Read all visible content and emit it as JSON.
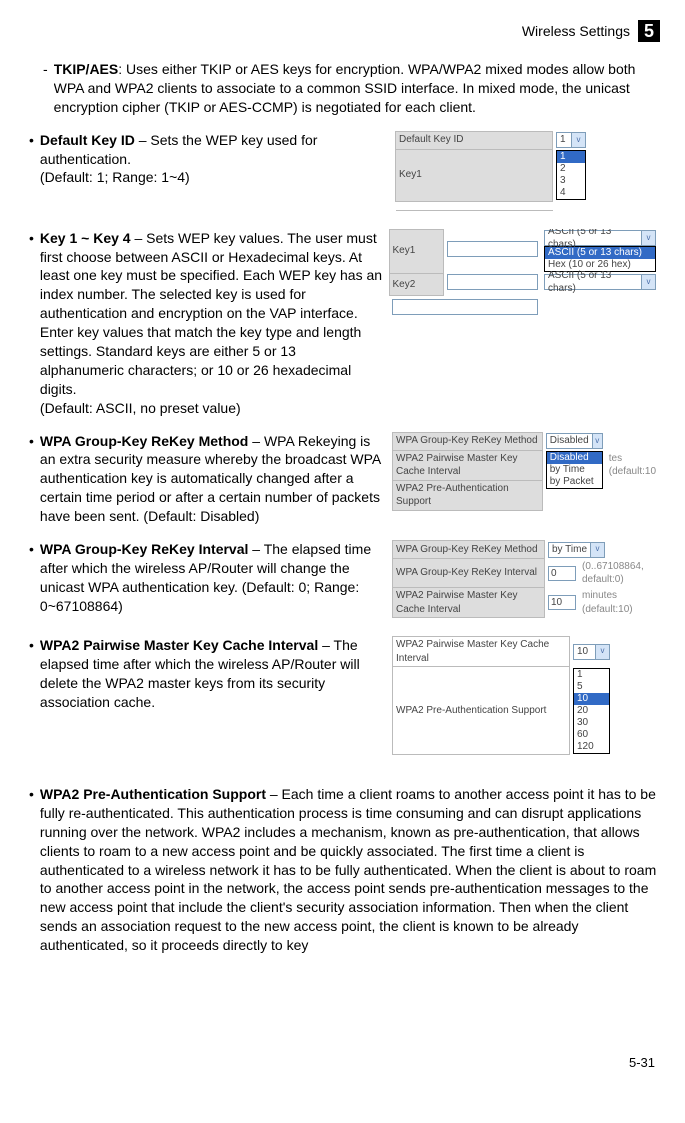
{
  "header": {
    "title": "Wireless Settings",
    "chapter": "5"
  },
  "tkip": {
    "heading": "TKIP/AES",
    "text": ": Uses either TKIP or AES keys for encryption. WPA/WPA2 mixed modes allow both WPA and WPA2 clients to associate to a common SSID interface. In mixed mode, the unicast encryption cipher (TKIP or AES-CCMP) is negotiated for each client."
  },
  "defaultKey": {
    "heading": "Default Key ID",
    "text": " – Sets the WEP key used for authentication.",
    "note": "(Default: 1; Range: 1~4)",
    "fig": {
      "row1": "Default Key ID",
      "row2": "Key1",
      "dd_current": "1",
      "options": [
        "1",
        "2",
        "3",
        "4"
      ]
    }
  },
  "keyRange": {
    "heading": "Key 1 ~ Key 4",
    "text": " – Sets WEP key values. The user must first choose between ASCII or Hexadecimal keys.  At least one key must be specified. Each WEP key has an index number. The selected key is used for authentication and encryption on the VAP interface. Enter key values that match the key type and length settings. Standard keys are either 5 or 13 alphanumeric characters; or 10 or 26 hexadecimal digits.",
    "note": "(Default: ASCII, no preset value)",
    "fig": {
      "row1": "Key1",
      "row2": "Key2",
      "dd1": "ASCII (5 or 13 chars)",
      "opts": [
        "ASCII (5 or 13 chars)",
        "Hex (10 or 26 hex)"
      ],
      "dd2": "ASCII (5 or 13 chars)"
    }
  },
  "rekeyMethod": {
    "heading": "WPA Group-Key ReKey Method",
    "text": " – WPA Rekeying is an extra security measure whereby the broadcast WPA authentication key is automatically changed after a certain time period or after a certain number of packets have been sent. (Default: Disabled)",
    "fig": {
      "r1": "WPA Group-Key ReKey Method",
      "r2": "WPA2 Pairwise Master Key Cache Interval",
      "r3": "WPA2 Pre-Authentication Support",
      "dd": "Disabled",
      "opts": [
        "Disabled",
        "by Time",
        "by Packet"
      ],
      "tail": "tes (default:10"
    }
  },
  "rekeyInterval": {
    "heading": "WPA Group-Key ReKey Interval",
    "text": " – The elapsed time after which the wireless AP/Router will change the unicast WPA authentication key. (Default: 0; Range: 0~67108864)",
    "fig": {
      "r1": "WPA Group-Key ReKey Method",
      "r1v": "by Time",
      "r2": "WPA Group-Key ReKey Interval",
      "r2v": "0",
      "r2note": "(0..67108864, default:0)",
      "r3": "WPA2 Pairwise Master Key Cache Interval",
      "r3v": "10",
      "r3note": "minutes (default:10)"
    }
  },
  "pairwise": {
    "heading": "WPA2 Pairwise Master Key Cache Interval",
    "text": " –  The elapsed time after which the wireless AP/Router will delete the WPA2 master keys from its security association cache.",
    "fig": {
      "r1": "WPA2 Pairwise Master Key Cache Interval",
      "r2": "WPA2 Pre-Authentication Support",
      "dd": "10",
      "opts": [
        "1",
        "5",
        "10",
        "20",
        "30",
        "60",
        "120"
      ]
    }
  },
  "preauth": {
    "heading": "WPA2 Pre-Authentication Support",
    "text": " – Each time a client roams to another access point it has to be fully re-authenticated. This authentication process is time consuming and can disrupt applications running over the network. WPA2 includes a mechanism, known as pre-authentication, that allows clients to roam to a new access point and be quickly associated. The first time a client is authenticated to a wireless network it has to be fully authenticated. When the client is about to roam to another access point in the network, the access point sends pre-authentication messages to the new access point that include the client's security association information. Then when the client sends an association request to the new access point, the client is known to be already authenticated, so it proceeds directly to key"
  },
  "pageNum": "5-31"
}
